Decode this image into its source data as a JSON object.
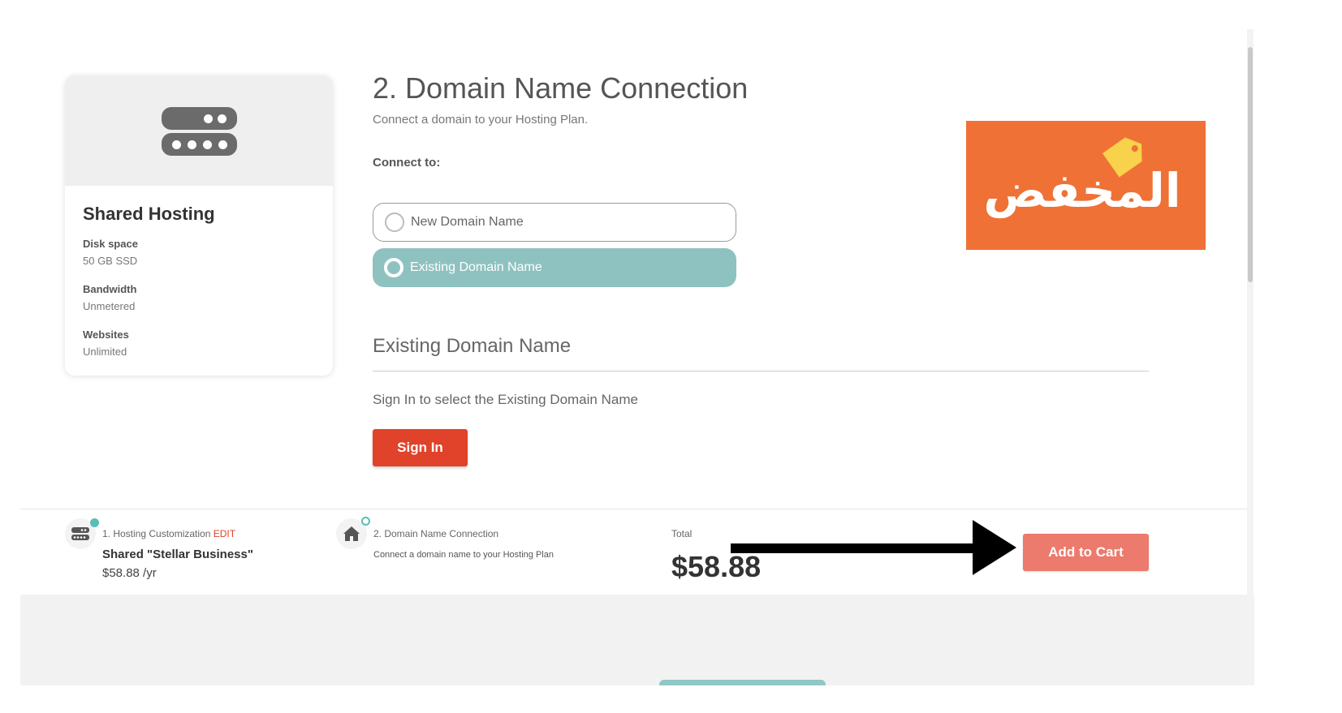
{
  "product": {
    "title": "Shared Hosting",
    "specs": [
      {
        "label": "Disk space",
        "value": "50 GB SSD"
      },
      {
        "label": "Bandwidth",
        "value": "Unmetered"
      },
      {
        "label": "Websites",
        "value": "Unlimited"
      }
    ]
  },
  "main": {
    "title": "2. Domain Name Connection",
    "subtitle": "Connect a domain to your Hosting Plan.",
    "connect_label": "Connect to:",
    "options": [
      {
        "label": "New Domain Name",
        "selected": false
      },
      {
        "label": "Existing Domain Name",
        "selected": true
      }
    ],
    "section_heading": "Existing Domain Name",
    "signin_prompt": "Sign In to select the Existing Domain Name",
    "signin_button": "Sign In"
  },
  "logo": {
    "text": "المخفض",
    "background": "#f07135"
  },
  "footer": {
    "step1": {
      "label": "1. Hosting Customization",
      "edit": "EDIT",
      "plan": "Shared \"Stellar Business\"",
      "price": "$58.88 /yr"
    },
    "step2": {
      "label": "2. Domain Name Connection",
      "description": "Connect a domain name to your Hosting Plan"
    },
    "total_label": "Total",
    "total_value": "$58.88",
    "add_to_cart": "Add to Cart"
  },
  "colors": {
    "accent_teal": "#8ec2c0",
    "signin_red": "#e0422a",
    "add_to_cart": "#ec7a6d"
  }
}
